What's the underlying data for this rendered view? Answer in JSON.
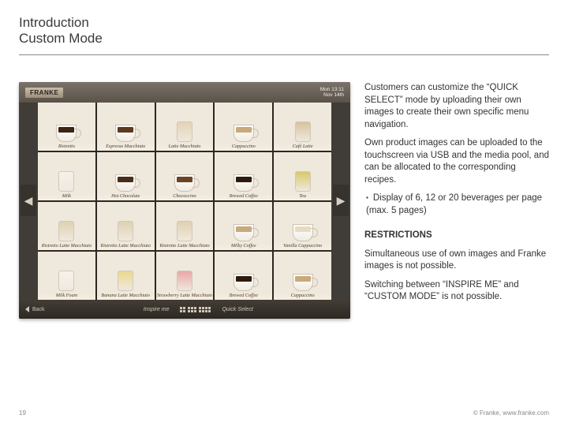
{
  "header": {
    "title": "Introduction",
    "subtitle": "Custom Mode"
  },
  "screen": {
    "brand": "FRANKE",
    "clock_time": "Mon 13:11",
    "clock_date": "Nov 14th",
    "back_label": "Back",
    "mode_left": "Inspire me",
    "mode_right": "Quick Select",
    "items": [
      {
        "label": "Ristretto",
        "shape": "cup",
        "liq": "#3a2416"
      },
      {
        "label": "Espresso Macchiato",
        "shape": "cup",
        "liq": "#5b3a20"
      },
      {
        "label": "Latte Macchiato",
        "shape": "glass",
        "liq": "#e3d4b8"
      },
      {
        "label": "Cappuccino",
        "shape": "cup",
        "liq": "#c9a97c"
      },
      {
        "label": "Café Latte",
        "shape": "glass",
        "liq": "#d8c29f"
      },
      {
        "label": "Milk",
        "shape": "glass",
        "liq": "#f4f2ec"
      },
      {
        "label": "Hot Chocolate",
        "shape": "cup",
        "liq": "#4a2c18"
      },
      {
        "label": "Chococcino",
        "shape": "cup",
        "liq": "#6d4326"
      },
      {
        "label": "Brewed Coffee",
        "shape": "cup",
        "liq": "#2e1a0d"
      },
      {
        "label": "Tea",
        "shape": "glass",
        "liq": "#d7c96a"
      },
      {
        "label": "Ristretto Latte Macchiato",
        "shape": "glass",
        "liq": "#e0d0b2"
      },
      {
        "label": "Ristretto Latte Macchiato",
        "shape": "glass",
        "liq": "#e0d0b2"
      },
      {
        "label": "Ristretto Latte Macchiato",
        "shape": "glass",
        "liq": "#e0d0b2"
      },
      {
        "label": "Milky Coffee",
        "shape": "cup",
        "liq": "#caa87d"
      },
      {
        "label": "Vanilla Cappuccino",
        "shape": "cup",
        "liq": "#e8dcc0"
      },
      {
        "label": "Milk Foam",
        "shape": "glass",
        "liq": "#f6f3eb"
      },
      {
        "label": "Banana Latte Macchiato",
        "shape": "glass",
        "liq": "#ead98f"
      },
      {
        "label": "Strawberry Latte Macchiato",
        "shape": "glass",
        "liq": "#e8a8a8"
      },
      {
        "label": "Brewed Coffee",
        "shape": "cup",
        "liq": "#2e1a0d"
      },
      {
        "label": "Cappuccino",
        "shape": "cup",
        "liq": "#c9a97c"
      }
    ]
  },
  "copy": {
    "p1": "Customers can customize the “QUICK SELECT” mode by uploading their own images to create their own specific menu navigation.",
    "p2": "Own product images can be uploaded to the touchscreen via USB and the media pool, and can be allocated to the corresponding recipes.",
    "bullet1": "Display of 6, 12 or 20 beverages per page (max. 5 pages)",
    "restrictions_heading": "RESTRICTIONS",
    "r1": "Simultaneous use of own images and Franke images is not possible.",
    "r2": "Switching between “INSPIRE ME” and “CUSTOM MODE” is not possible."
  },
  "footer": {
    "page": "19",
    "copyright": "© Franke, www.franke.com"
  }
}
